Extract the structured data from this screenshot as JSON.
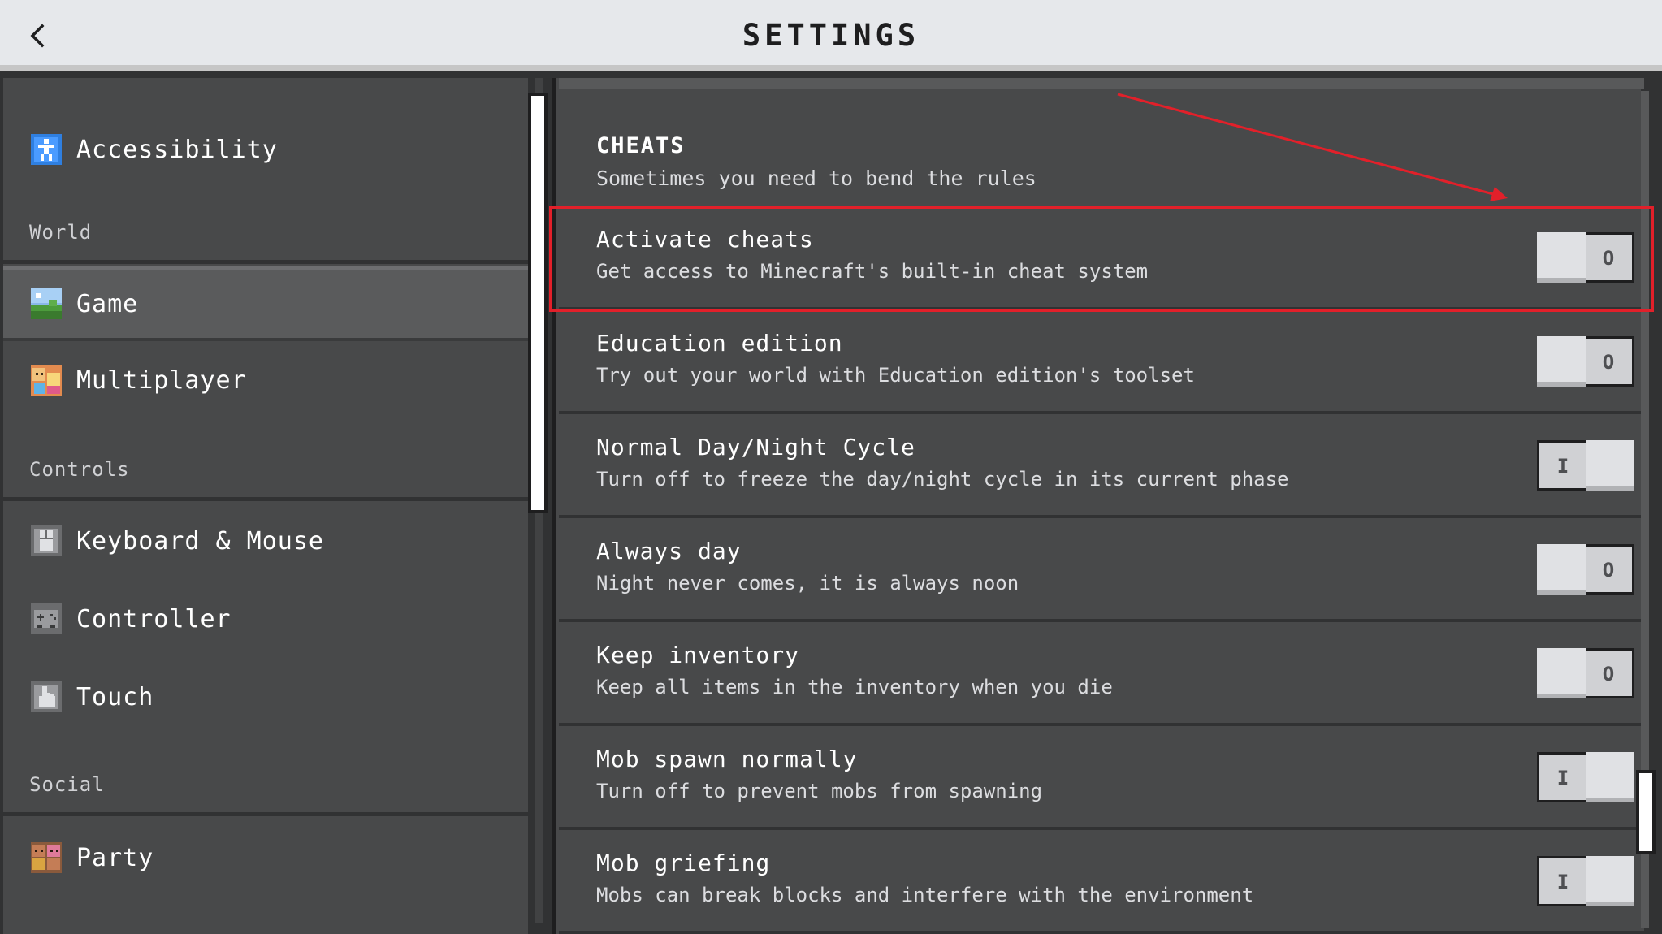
{
  "header": {
    "title": "SETTINGS",
    "back_icon": "chevron-left-icon"
  },
  "sidebar": {
    "items": [
      {
        "label": "Accessibility",
        "icon": "accessibility-icon"
      },
      {
        "label": "Game",
        "icon": "landscape-icon"
      },
      {
        "label": "Multiplayer",
        "icon": "multiplayer-icon"
      },
      {
        "label": "Keyboard & Mouse",
        "icon": "keyboard-mouse-icon"
      },
      {
        "label": "Controller",
        "icon": "controller-icon"
      },
      {
        "label": "Touch",
        "icon": "touch-icon"
      },
      {
        "label": "Party",
        "icon": "party-icon"
      }
    ],
    "sections": {
      "world": "World",
      "controls": "Controls",
      "social": "Social"
    },
    "selected": "Game"
  },
  "content": {
    "section_title": "CHEATS",
    "section_subtitle": "Sometimes you need to bend the rules",
    "settings": [
      {
        "title": "Activate cheats",
        "description": "Get access to Minecraft's built-in cheat system",
        "state": "off"
      },
      {
        "title": "Education edition",
        "description": "Try out your world with Education edition's toolset",
        "state": "off"
      },
      {
        "title": "Normal Day/Night Cycle",
        "description": "Turn off to freeze the day/night cycle in its current phase",
        "state": "on"
      },
      {
        "title": "Always day",
        "description": "Night never comes, it is always noon",
        "state": "off"
      },
      {
        "title": "Keep inventory",
        "description": "Keep all items in the inventory when you die",
        "state": "off"
      },
      {
        "title": "Mob spawn normally",
        "description": "Turn off to prevent mobs from spawning",
        "state": "on"
      },
      {
        "title": "Mob griefing",
        "description": "Mobs can break blocks and interfere with the environment",
        "state": "on"
      }
    ],
    "toggle_marks": {
      "on": "I",
      "off": "O"
    }
  },
  "annotation": {
    "color": "#e2202a",
    "target": "Activate cheats"
  }
}
